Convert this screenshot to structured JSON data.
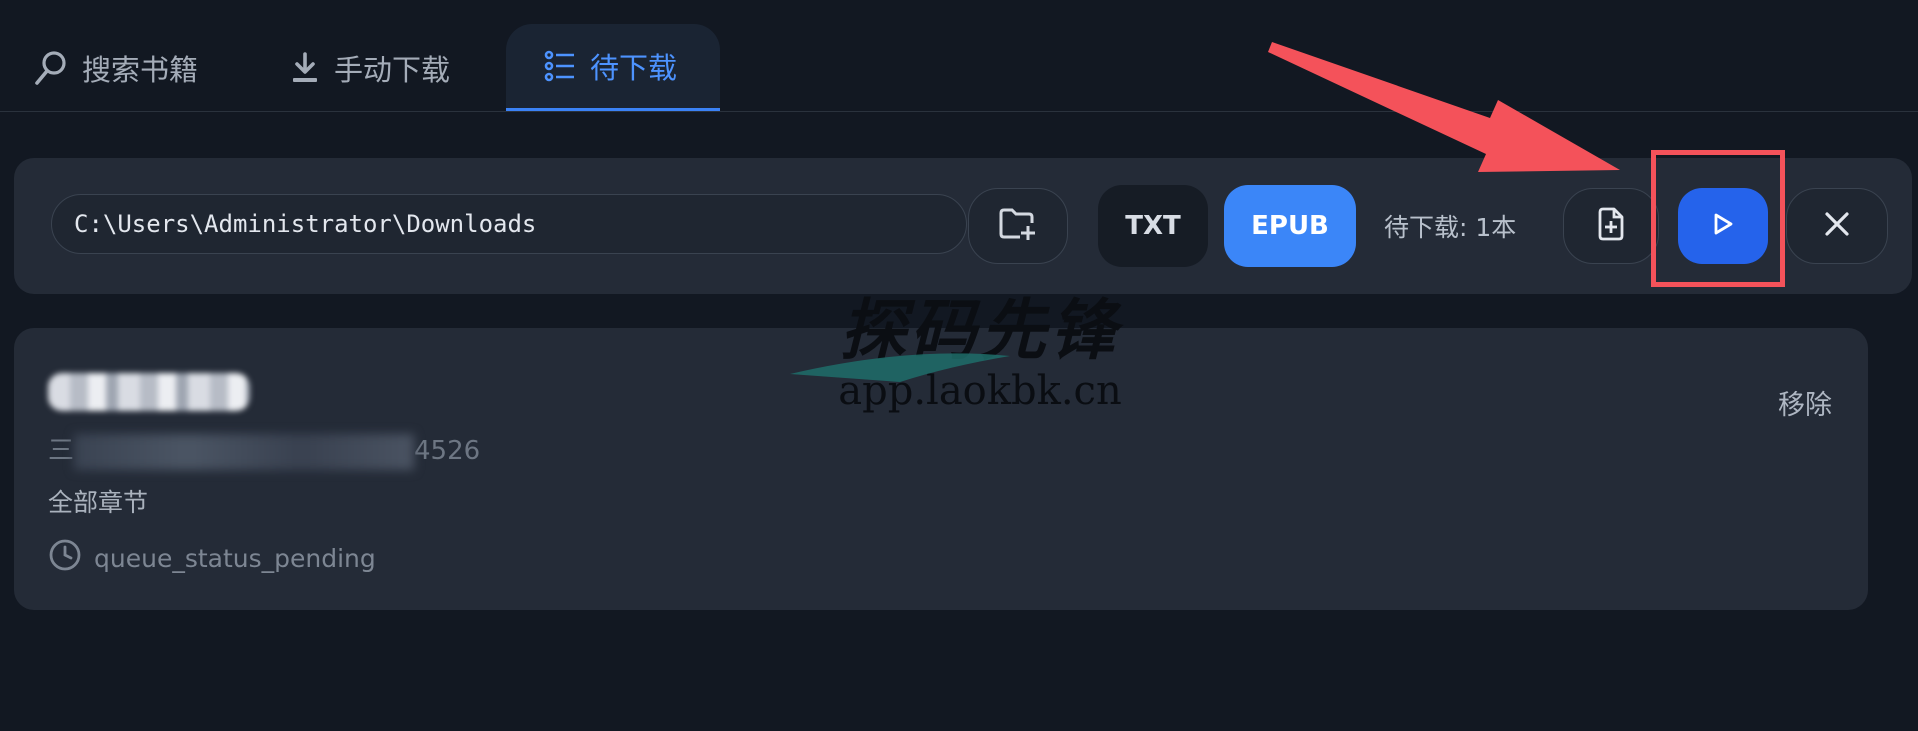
{
  "tabs": {
    "search": "搜索书籍",
    "manual": "手动下载",
    "queue": "待下载"
  },
  "toolbar": {
    "path_value": "C:\\Users\\Administrator\\Downloads",
    "txt_label": "TXT",
    "epub_label": "EPUB",
    "pending_count": "待下载: 1本"
  },
  "queue_item": {
    "title": "▇▇▇▇▇▇▇▇▇",
    "meta_prefix": "三",
    "meta_suffix": "4526",
    "chapters": "全部章节",
    "status": "queue_status_pending",
    "remove_label": "移除"
  },
  "watermark": {
    "logo": "探码先锋",
    "url": "app.laokbk.cn"
  },
  "colors": {
    "background": "#121822",
    "card": "#242b37",
    "accent": "#3b86f8",
    "start_button": "#2563eb",
    "annotation": "#f4525a"
  },
  "icons": [
    "search-icon",
    "download-icon",
    "list-icon",
    "folder-plus-icon",
    "file-plus-icon",
    "play-icon",
    "close-icon",
    "clock-icon"
  ]
}
